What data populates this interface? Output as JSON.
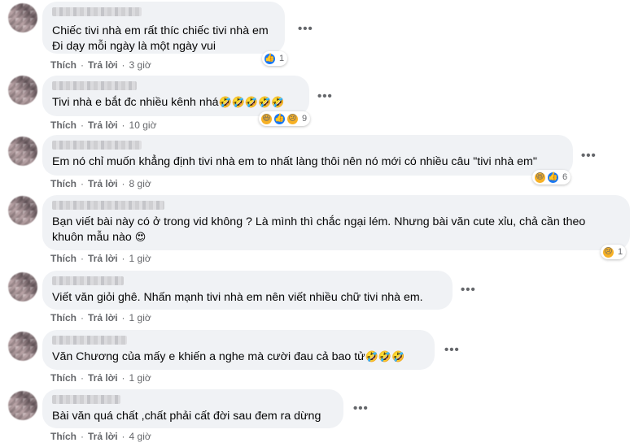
{
  "labels": {
    "like": "Thích",
    "reply": "Trả lời",
    "more": "•••"
  },
  "comments": [
    {
      "text": "Chiếc tivi nhà em rất thíc chiếc tivi nhà em\nĐi dạy mỗi ngày là một ngày vui",
      "time": "3 giờ",
      "reactions": [
        "like-icon"
      ],
      "reaction_count": "1"
    },
    {
      "text": "Tivi nhà e bắt đc nhiều kênh nhá",
      "emojis": "🤣🤣🤣🤣🤣",
      "time": "10 giờ",
      "reactions": [
        "haha-icon",
        "like-icon",
        "sad-icon"
      ],
      "reaction_count": "9"
    },
    {
      "text": "Em nó chỉ muốn khẳng định tivi nhà em to nhất làng thôi nên nó mới có nhiều câu \"tivi nhà em\"",
      "time": "8 giờ",
      "reactions": [
        "haha-icon",
        "like-icon"
      ],
      "reaction_count": "6"
    },
    {
      "text": "Bạn viết bài này có ở trong vid không ? Là mình thì chắc ngại lém. Nhưng bài văn cute xỉu, chả cần theo\nkhuôn mẫu nào",
      "emojis": "😍",
      "time": "1 giờ",
      "reactions": [
        "sad-icon"
      ],
      "reaction_count": "1"
    },
    {
      "text": "Viết văn giỏi ghê. Nhấn mạnh tivi nhà em nên viết nhiều chữ tivi nhà em.",
      "time": "1 giờ"
    },
    {
      "text": "Văn Chương của mấy e khiến a nghe mà cười đau cả bao tử",
      "emojis": "🤣🤣🤣",
      "time": "1 giờ"
    },
    {
      "text": "Bài văn quá chất ,chất phải cất đời sau đem ra dừng",
      "time": "4 giờ"
    }
  ],
  "colors": {
    "bubble": "#f0f2f5",
    "meta": "#65676b",
    "like": "#1877f2",
    "haha": "#f7b125"
  }
}
